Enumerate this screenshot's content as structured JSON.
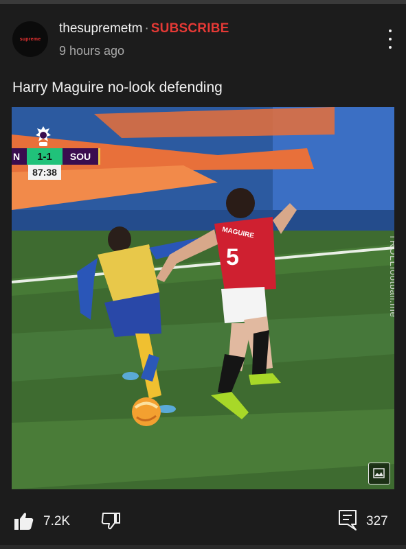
{
  "post": {
    "channel_name": "thesupremetm",
    "avatar_text": "supreme",
    "separator": "·",
    "subscribe_label": "SUBSCRIBE",
    "time_ago": "9 hours ago",
    "text": "Harry Maguire no-look defending"
  },
  "media": {
    "home_team_abbrev": "N",
    "score": "1-1",
    "away_team_abbrev": "SOU",
    "match_clock": "87:38",
    "watermark": "TROLLfootball.me",
    "shirt_number": "5",
    "shirt_name": "MAGUIRE"
  },
  "actions": {
    "like_count": "7.2K",
    "comment_count": "327"
  },
  "icons": {
    "menu": "more-vert-icon",
    "like": "thumb-up-icon",
    "dislike": "thumb-down-icon",
    "comment": "comment-icon",
    "image": "image-icon"
  },
  "colors": {
    "background": "#1c1c1c",
    "subscribe": "#e53935",
    "muted_text": "#aaaaaa",
    "score_green": "#20c27a",
    "team_purple": "#3a0d4f"
  }
}
